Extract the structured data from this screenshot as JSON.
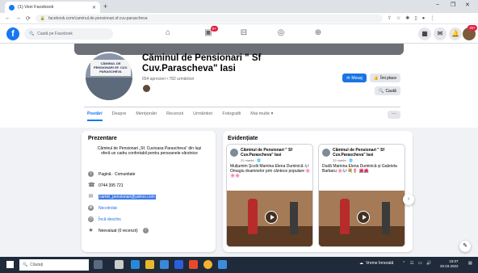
{
  "browser": {
    "tab_title": "(1) Vezi Facebook",
    "new_tab": "+",
    "url": "facebook.com/caminul.de.pensionari.sf.cuv.parascheva",
    "window_controls": [
      "–",
      "❐",
      "✕"
    ]
  },
  "facebook": {
    "search_placeholder": "Caută pe Facebook",
    "notifications_badge": "9+",
    "profile_badge": "20+"
  },
  "page": {
    "name": "Căminul de Pensionari \" Sf Cuv.Parascheva\" Iasi",
    "likes": "654 aprecieri • 782 urmăritori",
    "profile_sign": "CĂMINUL DE PENSIONARI SF. CUV. PARASCHEVA",
    "buttons": {
      "message": "Mesaj",
      "like": "Îmi place",
      "search": "Caută"
    },
    "tabs": [
      "Postări",
      "Despre",
      "Menționări",
      "Recenzii",
      "Urmăritori",
      "Fotografii",
      "Mai multe ▾"
    ],
    "more": "···"
  },
  "intro": {
    "title": "Prezentare",
    "description": "Căminul de Pensionari „Sf. Cuvioasa Parascheva” din Iași oferă un cadru confortabil pentru persoanele vârstnice",
    "rows": [
      {
        "icon": "info-icon",
        "text": "Pagină · Comunitate"
      },
      {
        "icon": "phone-icon",
        "text": "0744 395 721"
      },
      {
        "icon": "mail-icon",
        "text": "camin_pensionari@yahoo.com"
      },
      {
        "icon": "web-icon",
        "text": "Necotrolat"
      },
      {
        "icon": "clock-icon",
        "text": "Încă deschis"
      },
      {
        "icon": "star-icon",
        "text": "Neevaluat (0 recenzii)"
      }
    ]
  },
  "highlights": {
    "title": "Evidențiate",
    "posts": [
      {
        "author": "Căminul de Pensionari \" Sf Cuv.Parascheva\" Iasi",
        "date": "22 martie · 🌐",
        "text": "Mulțumim Școlii Mamina Elena Duminică 🎶 Omagiu doamnelor prin cântece populare 🌸🌸🌸"
      },
      {
        "author": "Căminul de Pensionari \" Sf Cuv.Parascheva\" Iasi",
        "date": "22 martie · 🌐",
        "text": "Dudă Mamina Elena Duminică și Gabriela Barbaru 🌸🎶💐🌷 🌺🌺"
      }
    ],
    "next": "›"
  },
  "taskbar": {
    "search": "Căutați",
    "weather": "Vreme înnorată",
    "time": "15:07",
    "date": "20.03.2022"
  }
}
